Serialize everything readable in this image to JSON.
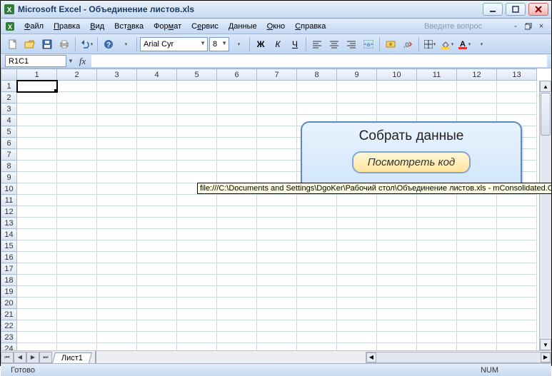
{
  "titlebar": {
    "app": "Microsoft Excel",
    "doc": "Объединение листов.xls"
  },
  "menubar": {
    "items": [
      "Файл",
      "Правка",
      "Вид",
      "Вставка",
      "Формат",
      "Сервис",
      "Данные",
      "Окно",
      "Справка"
    ],
    "help_placeholder": "Введите вопрос"
  },
  "toolbar": {
    "font_name": "Arial Cyr",
    "font_size": "8"
  },
  "formula": {
    "cellref": "R1C1",
    "fx": "fx"
  },
  "grid": {
    "cols": [
      "1",
      "2",
      "3",
      "4",
      "5",
      "6",
      "7",
      "8",
      "9",
      "10",
      "11",
      "12",
      "13"
    ],
    "rows": [
      "1",
      "2",
      "3",
      "4",
      "5",
      "6",
      "7",
      "8",
      "9",
      "10",
      "11",
      "12",
      "13",
      "14",
      "15",
      "16",
      "17",
      "18",
      "19",
      "20",
      "21",
      "22",
      "23",
      "24"
    ]
  },
  "shape": {
    "title": "Собрать данные",
    "button": "Посмотреть код"
  },
  "tooltip": "file:///C:\\Documents and Settings\\DgoKer\\Рабочий стол\\Объединение листов.xls - mConsolidated.C",
  "tabs": {
    "sheet1": "Лист1"
  },
  "status": {
    "ready": "Готово",
    "num": "NUM"
  }
}
